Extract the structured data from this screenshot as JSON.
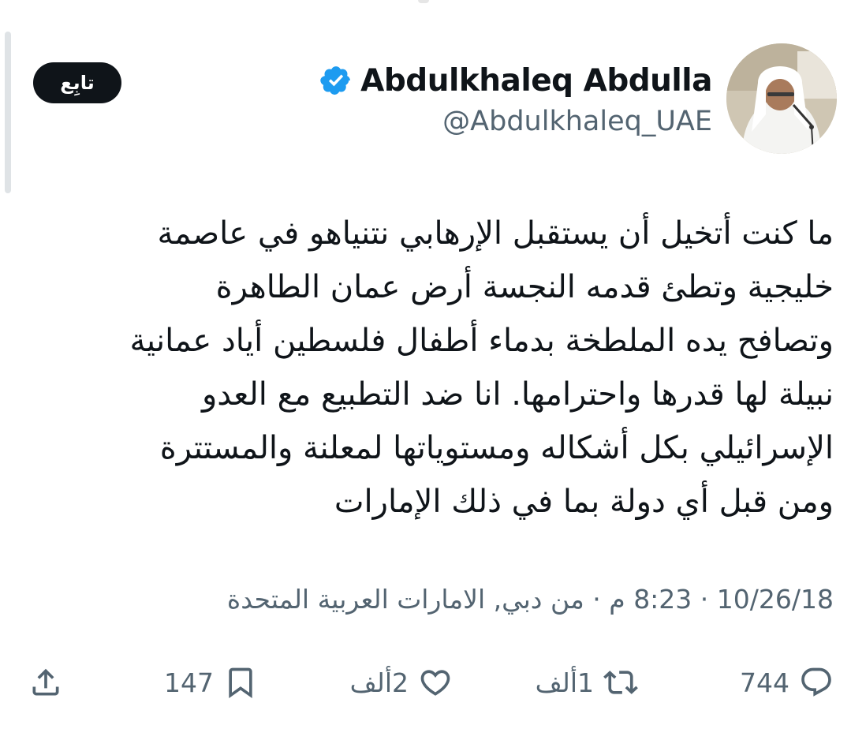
{
  "author": {
    "display_name": "Abdulkhaleq Abdulla",
    "handle": "@Abdulkhaleq_UAE",
    "verified": true
  },
  "follow_button": {
    "label": "تابِع"
  },
  "tweet": {
    "lines": [
      "ما كنت أتخيل أن يستقبل الإرهابي نتنياهو في عاصمة",
      "خليجية وتطئ قدمه النجسة أرض عمان الطاهرة",
      "وتصافح يده الملطخة بدماء أطفال فلسطين أياد عمانية",
      "نبيلة لها قدرها واحترامها. انا ضد التطبيع مع العدو",
      "الإسرائيلي بكل أشكاله ومستوياتها لمعلنة والمستترة",
      "ومن قبل أي دولة بما في ذلك الإمارات"
    ],
    "meta": "10/26/18 · 8:23 م · من دبي, الامارات العربية المتحدة"
  },
  "actions": {
    "replies": "744",
    "retweets": "1ألف",
    "likes": "2ألف",
    "bookmarks": "147"
  },
  "colors": {
    "text": "#0f1419",
    "secondary": "#536471",
    "verified": "#1d9bf0",
    "follow_bg": "#0f1419"
  }
}
